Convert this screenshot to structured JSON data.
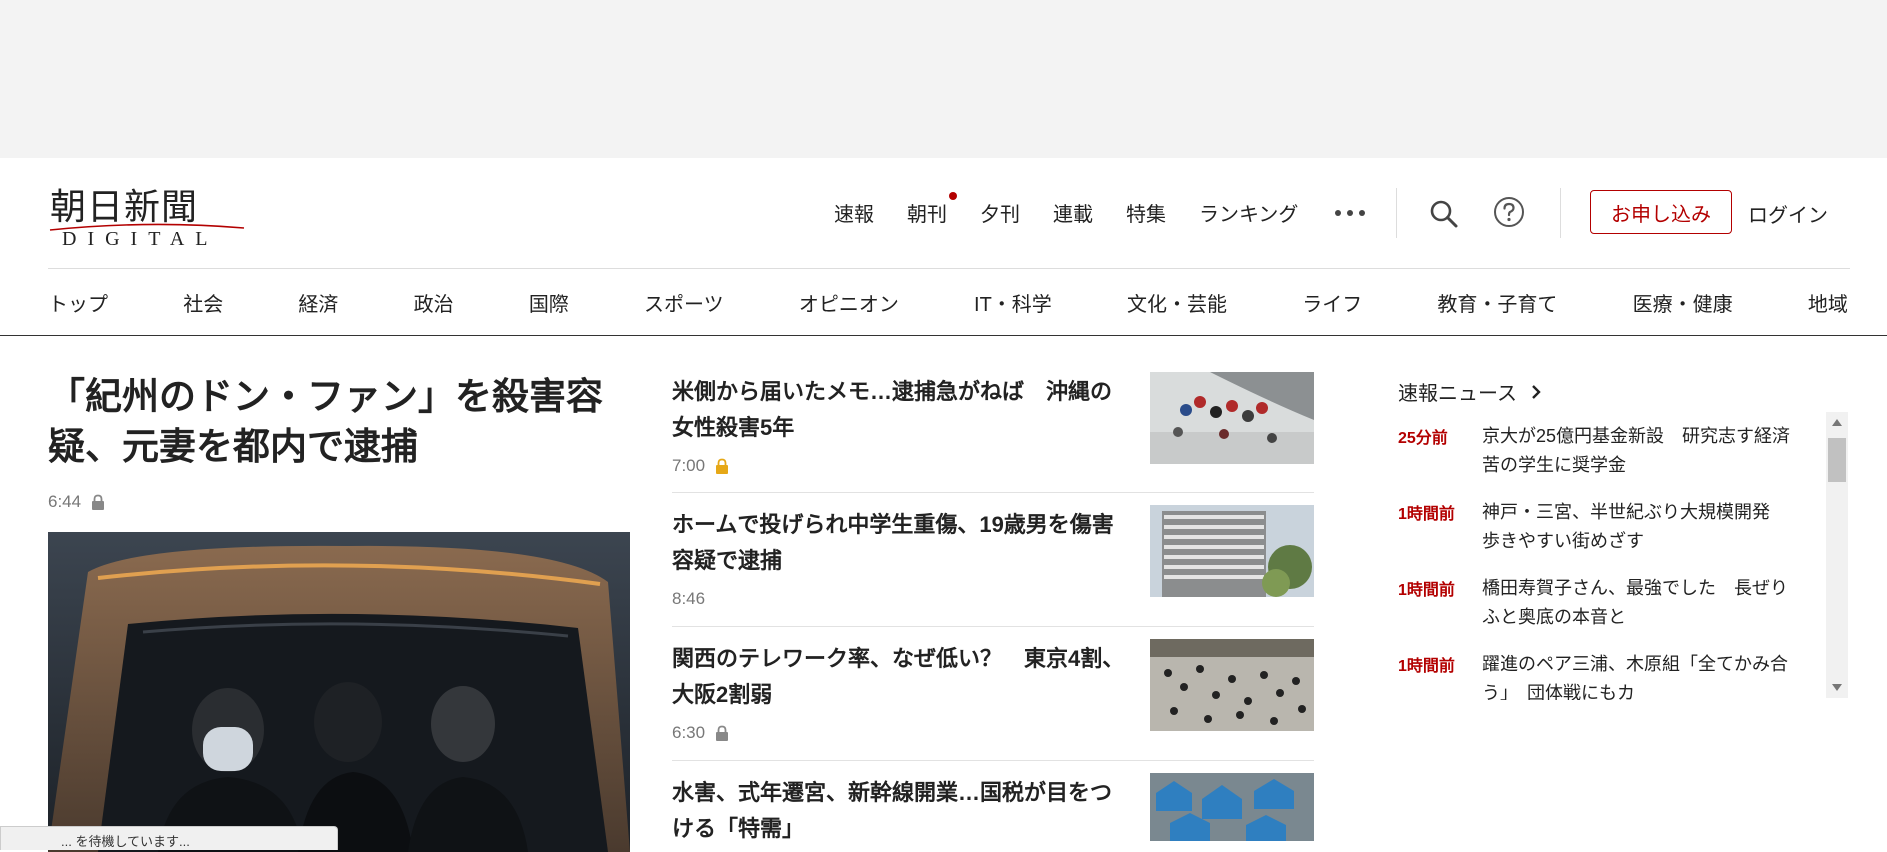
{
  "header": {
    "logo_jp": "朝日新聞",
    "logo_en": "DIGITAL",
    "top_nav": [
      "速報",
      "朝刊",
      "夕刊",
      "連載",
      "特集",
      "ランキング"
    ],
    "subscribe_label": "お申し込み",
    "login_label": "ログイン"
  },
  "category_nav": [
    "トップ",
    "社会",
    "経済",
    "政治",
    "国際",
    "スポーツ",
    "オピニオン",
    "IT・科学",
    "文化・芸能",
    "ライフ",
    "教育・子育て",
    "医療・健康",
    "地域"
  ],
  "lead": {
    "title": "「紀州のドン・ファン」を殺害容疑、元妻を都内で逮捕",
    "time": "6:44"
  },
  "articles": [
    {
      "title": "米側から届いたメモ…逮捕急がねば　沖縄の女性殺害5年",
      "time": "7:00",
      "premium": true,
      "lock_color": "#e6a817"
    },
    {
      "title": "ホームで投げられ中学生重傷、19歳男を傷害容疑で逮捕",
      "time": "8:46",
      "premium": false
    },
    {
      "title": "関西のテレワーク率、なぜ低い？　東京4割、大阪2割弱",
      "time": "6:30",
      "premium": true,
      "lock_color": "#888888"
    },
    {
      "title": "水害、式年遷宮、新幹線開業…国税が目をつける「特需」",
      "time": "",
      "premium": false
    }
  ],
  "breaking": {
    "heading": "速報ニュース",
    "items": [
      {
        "age": "25分前",
        "text": "京大が25億円基金新設　研究志す経済苦の学生に奨学金"
      },
      {
        "age": "1時間前",
        "text": "神戸・三宮、半世紀ぶり大規模開発　歩きやすい街めざす"
      },
      {
        "age": "1時間前",
        "text": "橋田寿賀子さん、最強でした　長ぜりふと奥底の本音と"
      },
      {
        "age": "1時間前",
        "text": "躍進のペア三浦、木原組「全てかみ合う」　団体戦にもカ"
      }
    ]
  },
  "status": {
    "text": "... を待機しています..."
  },
  "colors": {
    "accent": "#b30000",
    "premium_lock": "#e6a817"
  }
}
